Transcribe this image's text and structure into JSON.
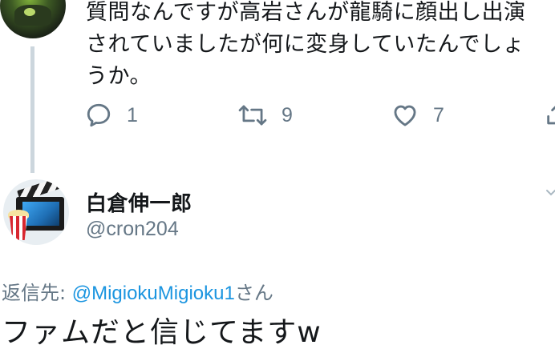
{
  "parent_tweet": {
    "text": "質問なんですが高岩さんが龍騎に顔出し出演されていましたが何に変身していたんでしょうか。",
    "reply_count": "1",
    "retweet_count": "9",
    "like_count": "7",
    "icons": {
      "reply": "reply-icon",
      "retweet": "retweet-icon",
      "like": "heart-icon",
      "share": "share-icon"
    }
  },
  "reply_tweet": {
    "display_name": "白倉伸一郎",
    "handle": "@cron204",
    "reply_to_prefix": "返信先: ",
    "reply_to_mention": "@MigiokuMigioku1",
    "reply_to_suffix": "さん",
    "text": "ファムだと信じてますw"
  },
  "colors": {
    "text": "#14171a",
    "secondary": "#657786",
    "link": "#1b95e0",
    "thread_line": "#ccd6dd"
  }
}
